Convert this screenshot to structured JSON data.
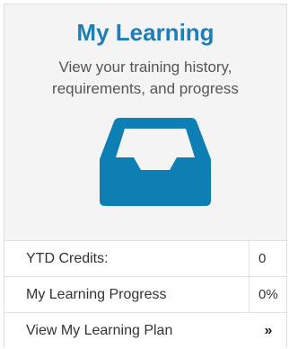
{
  "widget": {
    "title": "My Learning",
    "subtitle": "View your training history, requirements, and progress",
    "icon": "inbox-tray-icon",
    "accent_color": "#1e7fb8"
  },
  "stats": {
    "ytd_credits_label": "YTD Credits:",
    "ytd_credits_value": "0",
    "progress_label": "My Learning Progress",
    "progress_value": "0%"
  },
  "plan_link": {
    "label": "View My Learning Plan",
    "icon": "double-chevron-right-icon",
    "glyph": "»"
  }
}
